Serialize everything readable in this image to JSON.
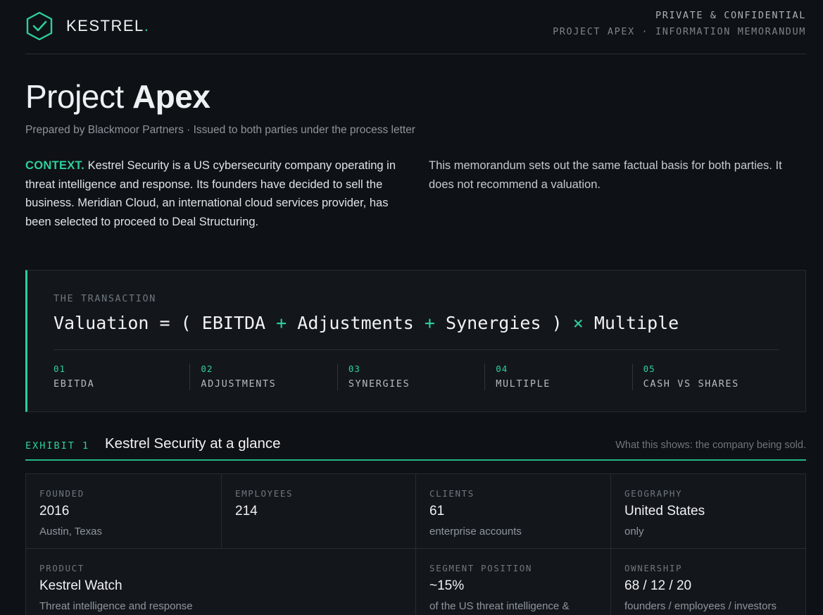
{
  "header": {
    "brand": "KESTREL",
    "brand_dot": ".",
    "confidential": "PRIVATE & CONFIDENTIAL",
    "doc_line": "PROJECT APEX · INFORMATION MEMORANDUM",
    "logo_icon": "shield-check-icon",
    "accent_color": "#2ecf9c"
  },
  "title": {
    "light": "Project",
    "bold": "Apex"
  },
  "subtitle": "Prepared by Blackmoor Partners · Issued to both parties under the process letter",
  "context": {
    "label": "CONTEXT.",
    "left_text": "Kestrel Security is a US cybersecurity company operating in threat intelligence and response. Its founders have decided to sell the business. Meridian Cloud, an international cloud services provider, has been selected to proceed to Deal Structuring.",
    "right_text": "This memorandum sets out the same factual basis for both parties. It does not recommend a valuation."
  },
  "transaction": {
    "label": "THE TRANSACTION",
    "formula": {
      "lhs": "Valuation",
      "eq": "=",
      "open": "(",
      "t1": "EBITDA",
      "op1": "+",
      "t2": "Adjustments",
      "op2": "+",
      "t3": "Synergies",
      "close": ")",
      "op3": "×",
      "t4": "Multiple"
    },
    "steps": [
      {
        "num": "01",
        "name": "EBITDA"
      },
      {
        "num": "02",
        "name": "ADJUSTMENTS"
      },
      {
        "num": "03",
        "name": "SYNERGIES"
      },
      {
        "num": "04",
        "name": "MULTIPLE"
      },
      {
        "num": "05",
        "name": "CASH VS SHARES"
      }
    ]
  },
  "exhibit": {
    "tag": "EXHIBIT 1",
    "title": "Kestrel Security at a glance",
    "note": "What this shows: the company being sold."
  },
  "facts": {
    "founded": {
      "key": "FOUNDED",
      "value": "2016",
      "sub": "Austin, Texas"
    },
    "employees": {
      "key": "EMPLOYEES",
      "value": "214",
      "sub": ""
    },
    "clients": {
      "key": "CLIENTS",
      "value": "61",
      "sub": "enterprise accounts"
    },
    "geography": {
      "key": "GEOGRAPHY",
      "value": "United States",
      "sub": "only"
    },
    "product": {
      "key": "PRODUCT",
      "value": "Kestrel Watch",
      "sub": "Threat intelligence and response"
    },
    "segment": {
      "key": "SEGMENT POSITION",
      "value": "~15%",
      "sub": "of the US threat intelligence & response segment"
    },
    "ownership": {
      "key": "OWNERSHIP",
      "value": "68 / 12 / 20",
      "sub": "founders / employees / investors"
    }
  }
}
